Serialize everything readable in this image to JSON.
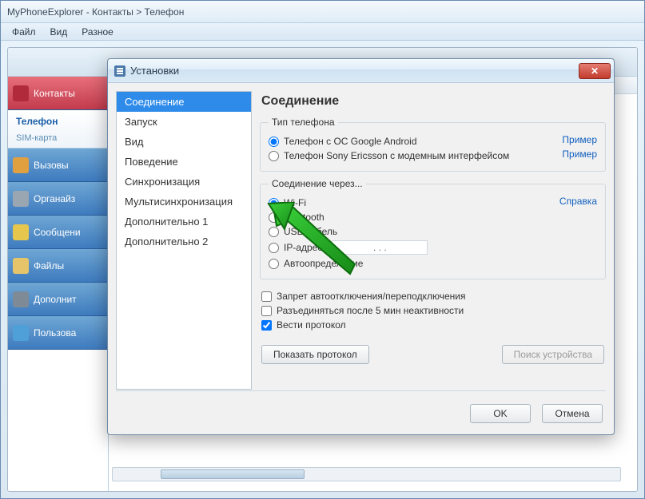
{
  "window": {
    "title": "MyPhoneExplorer -  Контакты > Телефон"
  },
  "menu": {
    "file": "Файл",
    "view": "Вид",
    "misc": "Разное"
  },
  "sidebar": {
    "contacts": "Контакты",
    "phone": "Телефон",
    "sim": "SIM-карта",
    "calls": "Вызовы",
    "organizer": "Органайз",
    "messages": "Сообщени",
    "files": "Файлы",
    "extra": "Дополнит",
    "user": "Пользова"
  },
  "dialog": {
    "title": "Установки",
    "nav": {
      "connection": "Соединение",
      "startup": "Запуск",
      "view": "Вид",
      "behavior": "Поведение",
      "sync": "Синхронизация",
      "multisync": "Мультисинхронизация",
      "extra1": "Дополнительно 1",
      "extra2": "Дополнительно 2"
    },
    "panel": {
      "heading": "Соединение",
      "phoneType_legend": "Тип телефона",
      "pt_android": "Телефон с ОС Google Android",
      "pt_sony": "Телефон Sony Ericsson с модемным интерфейсом",
      "example": "Пример",
      "connectVia_legend": "Соединение через...",
      "help": "Справка",
      "cv_wifi": "Wi-Fi",
      "cv_bt": "Bluetooth",
      "cv_usb": "USB-кабель",
      "cv_ip": "IP-адрес",
      "cv_ip_value": ".   .   .",
      "cv_auto": "Автоопределение",
      "chk_noreconnect": "Запрет автоотключения/переподключения",
      "chk_disconnect5": "Разъединяться после 5 мин неактивности",
      "chk_log": "Вести протокол",
      "btn_showlog": "Показать протокол",
      "btn_search": "Поиск устройства",
      "btn_ok": "OK",
      "btn_cancel": "Отмена"
    }
  }
}
